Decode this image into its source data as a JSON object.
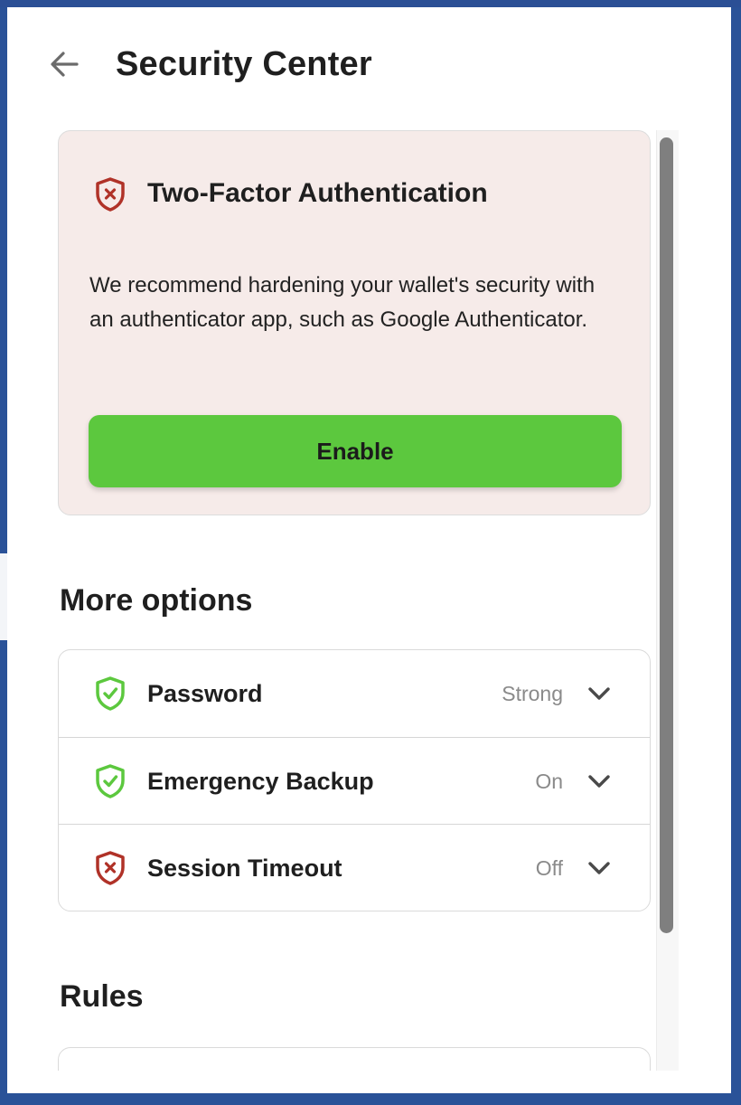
{
  "header": {
    "title": "Security Center",
    "back_icon": "arrow-left-icon"
  },
  "two_factor_card": {
    "icon": "shield-x-icon",
    "title": "Two-Factor Authentication",
    "description": "We recommend hardening your wallet's security with an authenticator app, such as Google Authenticator.",
    "button_label": "Enable",
    "colors": {
      "card_bg": "#f6ebe9",
      "button_bg": "#5cc83e",
      "danger": "#b03228"
    }
  },
  "more_options": {
    "title": "More options",
    "items": [
      {
        "label": "Password",
        "status": "Strong",
        "icon": "shield-check-icon",
        "state": "ok"
      },
      {
        "label": "Emergency Backup",
        "status": "On",
        "icon": "shield-check-icon",
        "state": "ok"
      },
      {
        "label": "Session Timeout",
        "status": "Off",
        "icon": "shield-x-icon",
        "state": "warning"
      }
    ],
    "colors": {
      "ok": "#5cc83e",
      "warning": "#b03228"
    }
  },
  "rules": {
    "title": "Rules"
  }
}
